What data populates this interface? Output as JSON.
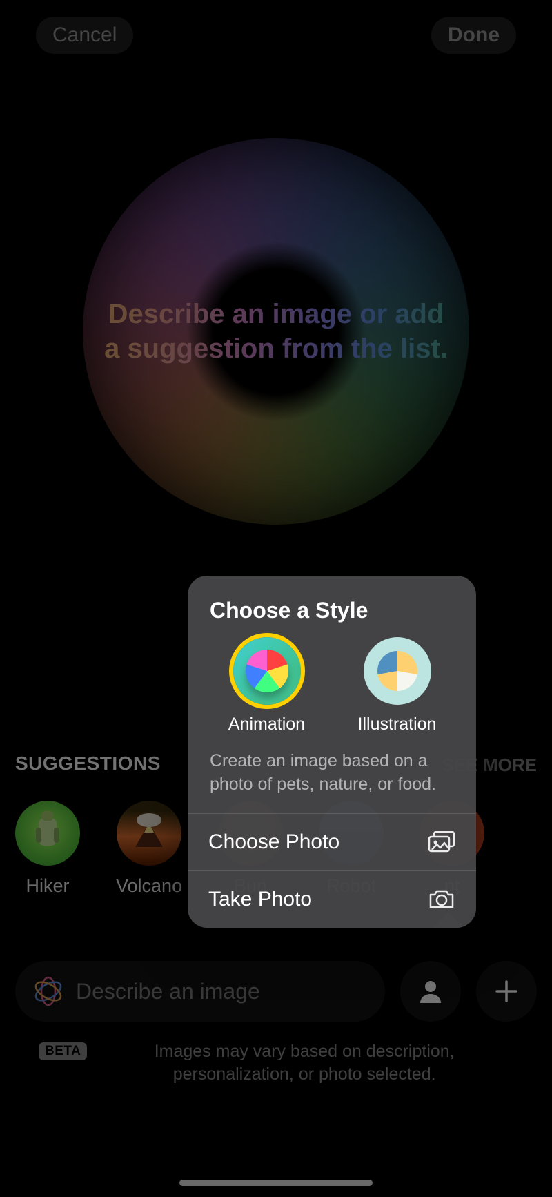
{
  "top": {
    "cancel": "Cancel",
    "done": "Done"
  },
  "hero": {
    "text": "Describe an image or add a suggestion from the list."
  },
  "suggestions": {
    "header": "SUGGESTIONS",
    "see_more": "SEE MORE",
    "items": [
      {
        "label": "Hiker"
      },
      {
        "label": "Volcano"
      },
      {
        "label": "Bun"
      },
      {
        "label": "Robot"
      },
      {
        "label": "nt"
      }
    ]
  },
  "input": {
    "placeholder": "Describe an image"
  },
  "footer": {
    "badge": "BETA",
    "text": "Images may vary based on description, personalization, or photo selected."
  },
  "popup": {
    "title": "Choose a Style",
    "styles": [
      {
        "label": "Animation",
        "selected": true
      },
      {
        "label": "Illustration",
        "selected": false
      }
    ],
    "subtitle": "Create an image based on a photo of pets, nature, or food.",
    "rows": [
      {
        "label": "Choose Photo",
        "icon": "photo-library-icon"
      },
      {
        "label": "Take Photo",
        "icon": "camera-icon"
      }
    ]
  }
}
